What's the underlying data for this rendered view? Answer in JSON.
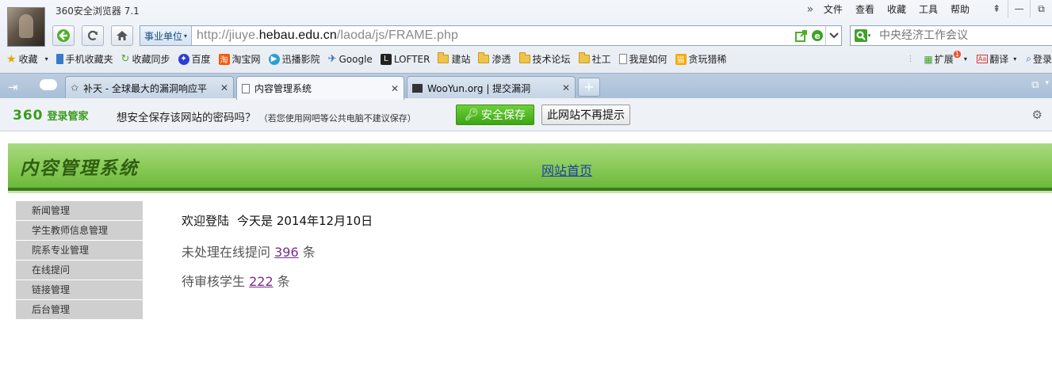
{
  "browser": {
    "title": "360安全浏览器 7.1",
    "menu": [
      "文件",
      "查看",
      "收藏",
      "工具",
      "帮助"
    ],
    "menu_overflow": "»",
    "window_controls": {
      "skin": "⇞",
      "minimize": "—",
      "maximize": "⧉"
    },
    "address": {
      "site_type": "事业单位",
      "url_prefix": "http://jiuye.",
      "url_host": "hebau.edu.cn",
      "url_path": "/laoda/js/FRAME.php"
    },
    "search": {
      "placeholder": "中央经济工作会议"
    },
    "bookmarks": [
      {
        "label": "收藏",
        "icon": "star-folder-icon"
      },
      {
        "label": "手机收藏夹",
        "icon": "phone-icon"
      },
      {
        "label": "收藏同步",
        "icon": "sync-icon"
      },
      {
        "label": "百度",
        "icon": "baidu-paw-icon"
      },
      {
        "label": "淘宝网",
        "icon": "taobao-icon"
      },
      {
        "label": "迅播影院",
        "icon": "play-icon"
      },
      {
        "label": "Google",
        "icon": "google-icon"
      },
      {
        "label": "LOFTER",
        "icon": "lofter-icon"
      },
      {
        "label": "建站",
        "icon": "folder-icon"
      },
      {
        "label": "渗透",
        "icon": "folder-icon"
      },
      {
        "label": "技术论坛",
        "icon": "folder-icon"
      },
      {
        "label": "社工",
        "icon": "folder-icon"
      },
      {
        "label": "我是如何",
        "icon": "page-icon"
      },
      {
        "label": "贪玩猎稀",
        "icon": "game-icon"
      }
    ],
    "toolbar_right": {
      "extensions": "扩展",
      "extensions_badge": "1",
      "translate": "翻译",
      "login": "登录"
    },
    "tabs": [
      {
        "label": "补天 - 全球最大的漏洞响应平",
        "active": false
      },
      {
        "label": "内容管理系统",
        "active": true
      },
      {
        "label": "WooYun.org | 提交漏洞",
        "active": false
      }
    ],
    "new_tab": "+",
    "password_bar": {
      "brand_num": "360",
      "brand_text": "登录管家",
      "message": "想安全保存该网站的密码吗？",
      "note": "（若您使用网吧等公共电脑不建议保存）",
      "save_label": "安全保存",
      "never_label": "此网站不再提示"
    }
  },
  "page": {
    "site_title": "内容管理系统",
    "home_link": "网站首页",
    "menu": [
      "新闻管理",
      "学生教师信息管理",
      "院系专业管理",
      "在线提问",
      "链接管理",
      "后台管理"
    ],
    "welcome": "欢迎登陆",
    "today_label": "今天是",
    "date": "2014年12月10日",
    "stat1_label": "未处理在线提问",
    "stat1_value": "396",
    "stat2_label": "待审核学生",
    "stat2_value": "222",
    "unit": "条"
  },
  "colors": {
    "header_green": "#8ccb5a",
    "save_green": "#3ea515",
    "link_purple": "#7b2d8b"
  }
}
